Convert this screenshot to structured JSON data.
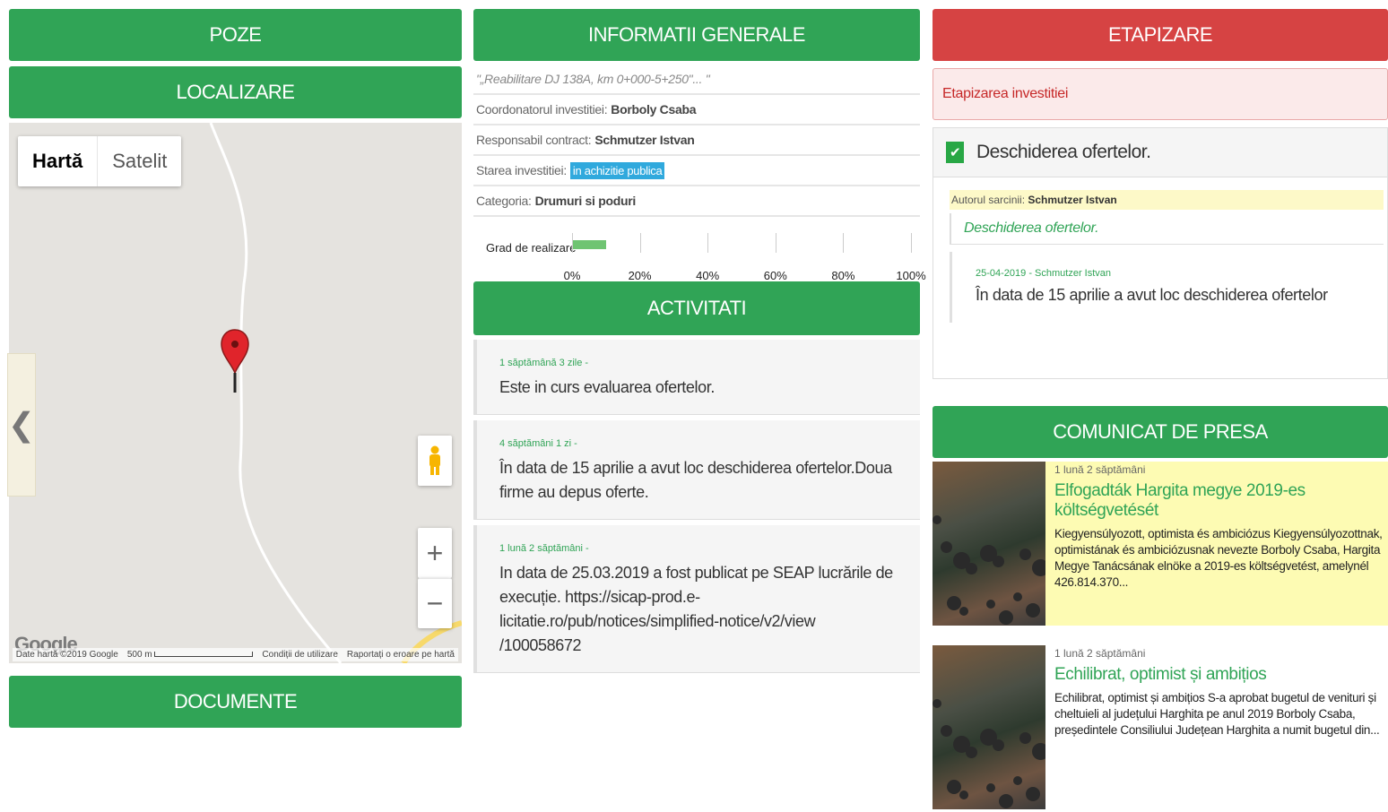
{
  "col1": {
    "poze": "POZE",
    "localizare": "LOCALIZARE",
    "documente": "DOCUMENTE",
    "map": {
      "type_map": "Hartă",
      "type_satellite": "Satelit",
      "google": "Google",
      "attribution": "Date hartă ©2019 Google",
      "scale": "500 m",
      "terms": "Condiții de utilizare",
      "report": "Raportați o eroare pe hartă",
      "zoom_in": "+",
      "zoom_out": "−",
      "prev": "❮"
    }
  },
  "col2": {
    "header": "INFORMATII GENERALE",
    "title": "\"„Reabilitare DJ 138A, km 0+000-5+250\"... \"",
    "coordinator_label": "Coordonatorul investitiei:",
    "coordinator": "Borboly Csaba",
    "responsible_label": "Responsabil contract:",
    "responsible": "Schmutzer Istvan",
    "status_label": "Starea investitiei:",
    "status": "in achizitie publica",
    "category_label": "Categoria:",
    "category": "Drumuri si poduri",
    "progress_label": "Grad de realizare",
    "progress_value": 0.1,
    "ticks": [
      "0%",
      "20%",
      "40%",
      "60%",
      "80%",
      "100%"
    ],
    "activities_header": "ACTIVITATI",
    "activities": [
      {
        "time": "1 săptămână 3 zile -",
        "text": "Este in curs evaluarea ofertelor."
      },
      {
        "time": "4 săptămâni 1 zi -",
        "text": "În data de 15 aprilie a avut loc deschiderea ofertelor.Doua firme au depus oferte."
      },
      {
        "time": "1 lună 2 săptămâni -",
        "text": "In data de 25.03.2019 a fost publicat pe SEAP lucrările de execuție. https://sicap-prod.e-licitatie.ro/pub/notices/simplified-notice/v2/view /100058672"
      }
    ]
  },
  "col3": {
    "header": "ETAPIZARE",
    "alert": "Etapizarea investitiei",
    "task_title": "Deschiderea ofertelor.",
    "author_label": "Autorul sarcinii:",
    "author": "Schmutzer Istvan",
    "task_desc": "Deschiderea ofertelor.",
    "update_meta": "25-04-2019 - Schmutzer Istvan",
    "update_text": "În data de 15 aprilie a avut loc deschiderea ofertelor",
    "press_header": "COMUNICAT DE PRESA",
    "press": [
      {
        "time": "1 lună 2 săptămâni",
        "title": "Elfogadták Hargita megye 2019-es költségvetését",
        "summary": "Kiegyensúlyozott, optimista és ambiciózus Kiegyensúlyozottnak, optimistának és ambiciózusnak nevezte Borboly Csaba, Hargita Megye Tanácsának elnöke a 2019-es költségvetést, amelynél 426.814.370..."
      },
      {
        "time": "1 lună 2 săptămâni",
        "title": "Echilibrat, optimist și ambițios",
        "summary": "Echilibrat, optimist și ambițios S-a aprobat bugetul de venituri și cheltuieli al județului Harghita pe anul 2019 Borboly Csaba, președintele Consiliului Județean Harghita a numit bugetul din..."
      }
    ]
  },
  "colors": {
    "green": "#30a456",
    "red": "#d64343",
    "badge": "#30a9dd"
  }
}
